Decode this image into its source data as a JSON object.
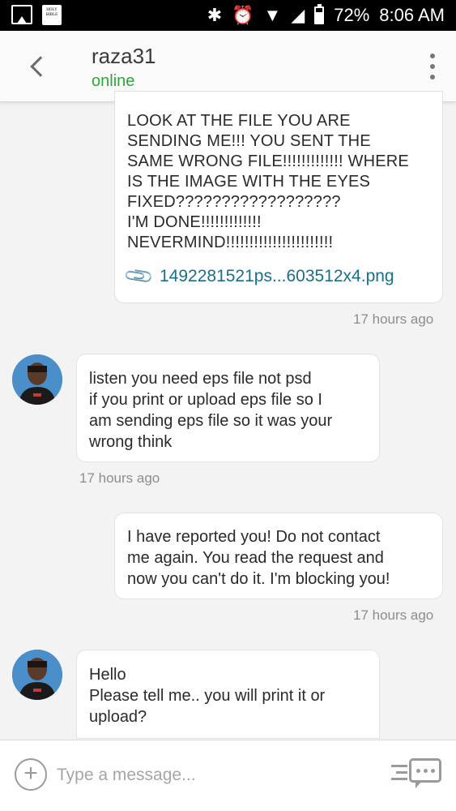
{
  "status_bar": {
    "battery": "72%",
    "time": "8:06 AM",
    "bible_icon_text": "HOLY BIBLE"
  },
  "header": {
    "contact_name": "raza31",
    "contact_status": "online"
  },
  "messages": [
    {
      "direction": "outgoing",
      "text": "LOOK AT THE FILE YOU ARE\nSENDING ME!!! YOU SENT THE\nSAME WRONG FILE!!!!!!!!!!!!! WHERE\nIS THE IMAGE WITH THE EYES\nFIXED??????????????????\nI'M DONE!!!!!!!!!!!!!\nNEVERMIND!!!!!!!!!!!!!!!!!!!!!!!",
      "attachment": "1492281521ps...603512x4.png",
      "time": "17 hours ago"
    },
    {
      "direction": "incoming",
      "text": "listen you need eps file not psd\nif you print or upload eps file so I\nam sending eps file so it was your\nwrong think",
      "time": "17 hours ago"
    },
    {
      "direction": "outgoing",
      "text": "I have reported you! Do not contact\nme again. You read the request and\nnow you can't do it. I'm blocking you!",
      "time": "17 hours ago"
    },
    {
      "direction": "incoming",
      "text": "Hello\nPlease tell me.. you will print it or\nupload?"
    }
  ],
  "input": {
    "placeholder": "Type a message...",
    "value": ""
  },
  "colors": {
    "online": "#2da63b",
    "link": "#1a6e8a",
    "timestamp": "#8d8d8d"
  }
}
